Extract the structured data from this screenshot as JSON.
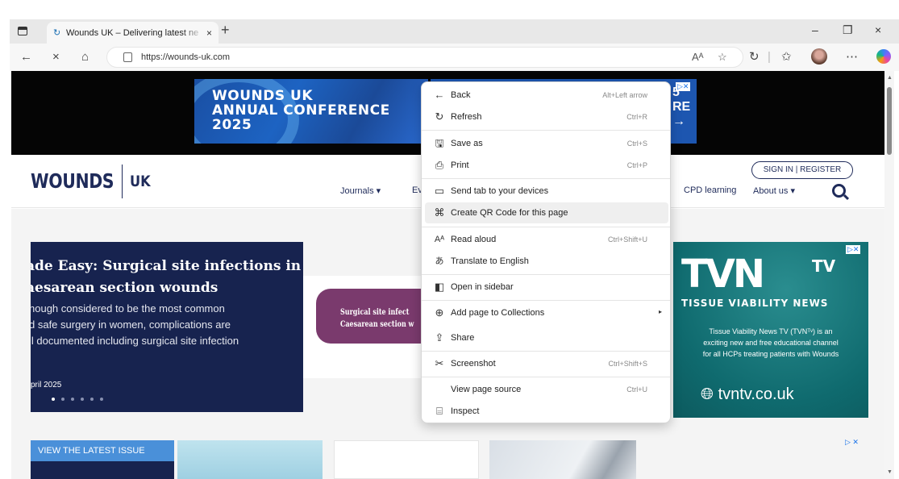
{
  "browser": {
    "tab_title": "Wounds UK – Delivering latest ne",
    "tab_close": "×",
    "new_tab": "+",
    "window_controls": [
      "–",
      "❐",
      "×"
    ],
    "nav": {
      "back": "←",
      "close": "×",
      "home": "⌂"
    },
    "url": "https://wounds-uk.com",
    "url_icons": [
      "Aᴬ",
      "☆"
    ],
    "toolbar_icons": [
      "↻",
      "|",
      "✩",
      "⋯"
    ]
  },
  "banner_ad": {
    "lines": [
      "WOUNDS UK",
      "ANNUAL CONFERENCE",
      "2025"
    ],
    "right_text": [
      "5",
      "RE",
      "→"
    ],
    "ad_marker": "▷✕"
  },
  "site": {
    "logo": "WOUNDS",
    "logo_uk": "UK",
    "nav": {
      "journals": "Journals  ▾",
      "events_fragment": "Ev",
      "cpd": "CPD learning",
      "about": "About us  ▾"
    },
    "signin": "SIGN IN | REGISTER"
  },
  "hero": {
    "title_line1": "ade Easy: Surgical site infections in",
    "title_line2": "aesarean section wounds",
    "body_line1": "hough considered to be the most common",
    "body_line2": "d safe surgery in women, complications are",
    "body_line3": "ll documented including surgical site infection",
    "date": "pril 2025",
    "pill_line1": "Surgical site infect",
    "pill_line2": "Caesarean section w"
  },
  "tvn_ad": {
    "logo": "TVN",
    "tv": "TV",
    "subtitle": "TISSUE VIABILITY NEWS",
    "desc_line1": "Tissue Viability News TV (TVNᵀᵛ) is an",
    "desc_line2": "exciting new and free educational channel",
    "desc_line3": "for all HCPs treating patients with Wounds",
    "website": "tvntv.co.uk",
    "ad_marker": "▷✕"
  },
  "latest": {
    "label": "VIEW THE LATEST ISSUE"
  },
  "bottom_ad_marker": "▷ ✕",
  "context_menu": {
    "items": [
      {
        "icon": "←",
        "label": "Back",
        "shortcut": "Alt+Left arrow"
      },
      {
        "icon": "↻",
        "label": "Refresh",
        "shortcut": "Ctrl+R"
      },
      {
        "icon": "🖫",
        "label": "Save as",
        "shortcut": "Ctrl+S"
      },
      {
        "icon": "⎙",
        "label": "Print",
        "shortcut": "Ctrl+P"
      },
      {
        "icon": "▭",
        "label": "Send tab to your devices",
        "shortcut": ""
      },
      {
        "icon": "⌘",
        "label": "Create QR Code for this page",
        "shortcut": ""
      },
      {
        "icon": "Aᴬ",
        "label": "Read aloud",
        "shortcut": "Ctrl+Shift+U"
      },
      {
        "icon": "あ",
        "label": "Translate to English",
        "shortcut": ""
      },
      {
        "icon": "◧",
        "label": "Open in sidebar",
        "shortcut": ""
      },
      {
        "icon": "⊕",
        "label": "Add page to Collections",
        "shortcut": "",
        "arrow": "▸"
      },
      {
        "icon": "⇪",
        "label": "Share",
        "shortcut": ""
      },
      {
        "icon": "✂",
        "label": "Screenshot",
        "shortcut": "Ctrl+Shift+S"
      },
      {
        "icon": "",
        "label": "View page source",
        "shortcut": "Ctrl+U"
      },
      {
        "icon": "⌸",
        "label": "Inspect",
        "shortcut": ""
      }
    ]
  }
}
